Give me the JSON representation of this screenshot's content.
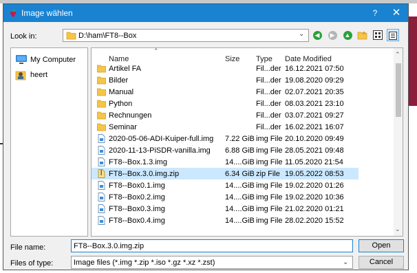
{
  "window": {
    "title": "Image wählen",
    "help_label": "?",
    "close_label": "✕",
    "title_bar_color": "#1983d2",
    "icon": "raspberry-icon"
  },
  "lookin": {
    "label": "Look in:",
    "path": "D:\\ham\\FT8--Box",
    "icon": "folder-icon"
  },
  "toolbar": {
    "icons": [
      "back-icon",
      "forward-icon",
      "up-folder-icon",
      "new-folder-icon",
      "list-view-icon",
      "detail-view-icon"
    ]
  },
  "sidebar": {
    "items": [
      {
        "label": "My Computer",
        "icon": "computer-icon"
      },
      {
        "label": "heert",
        "icon": "user-icon"
      }
    ]
  },
  "columns": {
    "name": "Name",
    "size": "Size",
    "type": "Type",
    "date": "Date Modified"
  },
  "files": [
    {
      "name": "Artikel FA",
      "size": "",
      "type": "Fil...der",
      "date": "16.12.2021 07:50",
      "icon": "folder-icon"
    },
    {
      "name": "Bilder",
      "size": "",
      "type": "Fil...der",
      "date": "19.08.2020 09:29",
      "icon": "folder-icon"
    },
    {
      "name": "Manual",
      "size": "",
      "type": "Fil...der",
      "date": "02.07.2021 20:35",
      "icon": "folder-icon"
    },
    {
      "name": "Python",
      "size": "",
      "type": "Fil...der",
      "date": "08.03.2021 23:10",
      "icon": "folder-icon"
    },
    {
      "name": "Rechnungen",
      "size": "",
      "type": "Fil...der",
      "date": "03.07.2021 09:27",
      "icon": "folder-icon"
    },
    {
      "name": "Seminar",
      "size": "",
      "type": "Fil...der",
      "date": "16.02.2021 16:07",
      "icon": "folder-icon"
    },
    {
      "name": "2020-05-06-ADI-Kuiper-full.img",
      "size": "7.22 GiB",
      "type": "img File",
      "date": "20.10.2020 09:49",
      "icon": "file-icon"
    },
    {
      "name": "2020-11-13-PiSDR-vanilla.img",
      "size": "6.88 GiB",
      "type": "img File",
      "date": "28.05.2021 09:48",
      "icon": "file-icon"
    },
    {
      "name": "FT8--Box.1.3.img",
      "size": "14....GiB",
      "type": "img File",
      "date": "11.05.2020 21:54",
      "icon": "file-icon"
    },
    {
      "name": "FT8--Box.3.0.img.zip",
      "size": "6.34 GiB",
      "type": "zip File",
      "date": "19.05.2022 08:53",
      "icon": "zip-file-icon",
      "selected": true
    },
    {
      "name": "FT8--Box0.1.img",
      "size": "14....GiB",
      "type": "img File",
      "date": "19.02.2020 01:26",
      "icon": "file-icon"
    },
    {
      "name": "FT8--Box0.2.img",
      "size": "14....GiB",
      "type": "img File",
      "date": "19.02.2020 10:36",
      "icon": "file-icon"
    },
    {
      "name": "FT8--Box0.3.img",
      "size": "14....GiB",
      "type": "img File",
      "date": "21.02.2020 01:21",
      "icon": "file-icon"
    },
    {
      "name": "FT8--Box0.4.img",
      "size": "14....GiB",
      "type": "img File",
      "date": "28.02.2020 15:52",
      "icon": "file-icon"
    }
  ],
  "filename": {
    "label": "File name:",
    "value": "FT8--Box.3.0.img.zip"
  },
  "filetype": {
    "label": "Files of type:",
    "value": "Image files (*.img *.zip *.iso *.gz *.xz *.zst)"
  },
  "buttons": {
    "open": "Open",
    "cancel": "Cancel"
  },
  "colors": {
    "selection": "#cce8ff",
    "accent": "#1983d2",
    "folder": "#f5c54a"
  }
}
